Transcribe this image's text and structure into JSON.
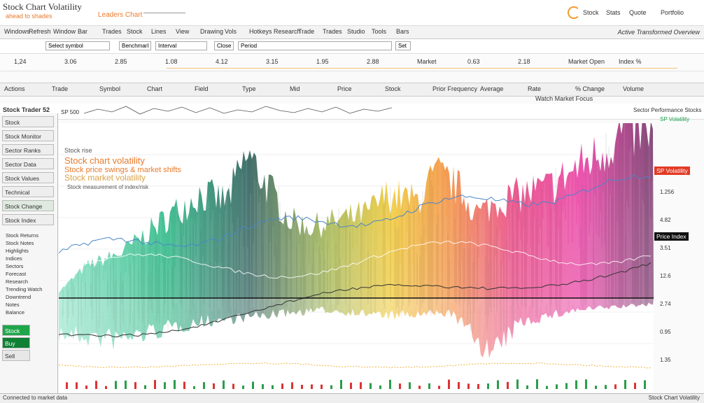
{
  "app": {
    "title": "Stock Chart Volatility",
    "subtitle_left": "ahead to shades",
    "subtitle_right": "Leaders Chart"
  },
  "header_right": {
    "labels": [
      "Stock",
      "Stats",
      "Quote",
      "Portfolio"
    ]
  },
  "menu": {
    "items": [
      "Windows",
      "Refresh",
      "Window",
      "Bar",
      "Trades",
      "Stock",
      "Lines",
      "View",
      "Drawing",
      "Vols",
      "Hotkeys",
      "Research",
      "Trade",
      "Trades",
      "Studio",
      "Tools",
      "Bars"
    ],
    "right_label": "Active Transformed Overview"
  },
  "toolbar": {
    "field1": "Select symbol",
    "field2": "Benchmark",
    "field3": "Interval",
    "field4": "Close",
    "field5": "Period",
    "right_field": "Set"
  },
  "stats_row": [
    "1,24",
    "3.06",
    "2.85",
    "1.08",
    "4.12",
    "3.15",
    "1.95",
    "2.88",
    "Market",
    "0.63",
    "2.18",
    "Market Open",
    "Index %"
  ],
  "columns": [
    "Actions",
    "Trade",
    "Symbol",
    "Chart",
    "Field",
    "Type",
    "Mid",
    "Price",
    "Stock",
    "Prior Frequency",
    "Average",
    "Rate",
    "% Change",
    "Volume"
  ],
  "tickerbar": {
    "label": "Stock Trader 52",
    "symbol": "SP 500",
    "right": "Watch Market Focus"
  },
  "sidebar": {
    "items": [
      "Stock",
      "Stock Monitor",
      "Sector Ranks",
      "Sector Data",
      "Stock Values",
      "Technical",
      "Stock Change",
      "Stock Index"
    ],
    "sub_items": [
      "Stock Returns",
      "Stock Notes",
      "Highlights",
      "Indices",
      "Sectors",
      "Forecast",
      "Research",
      "Trending Watch",
      "Downtrend",
      "Notes",
      "Balance"
    ],
    "buttons": [
      "Stock",
      "Buy",
      "Sell"
    ]
  },
  "chart_overlay": {
    "caption": "Stock rise",
    "heading": "Stock chart volatility",
    "line2": "Stock price swings & market shifts",
    "line3": "Stock market volatility",
    "line4": "Stock measurement of index/risk"
  },
  "right_panel": {
    "title": "Sector Performance Stocks",
    "tag1": "SP Volatility",
    "tag2": "Price Index",
    "values": [
      "1.256",
      "4.82",
      "3.51",
      "12.6",
      "2.74",
      "0.95",
      "1.35"
    ]
  },
  "status": {
    "left": "Connected to market data",
    "right": "Stock Chart Volatility"
  },
  "colors": {
    "accent": "#f39a2c",
    "bg": "#fafafa",
    "gradient_green": "#1fb47f",
    "gradient_teal": "#2c5e5a",
    "gradient_orange": "#f28a3c",
    "gradient_magenta": "#e83ca2",
    "line_blue": "#4a86c8"
  }
}
